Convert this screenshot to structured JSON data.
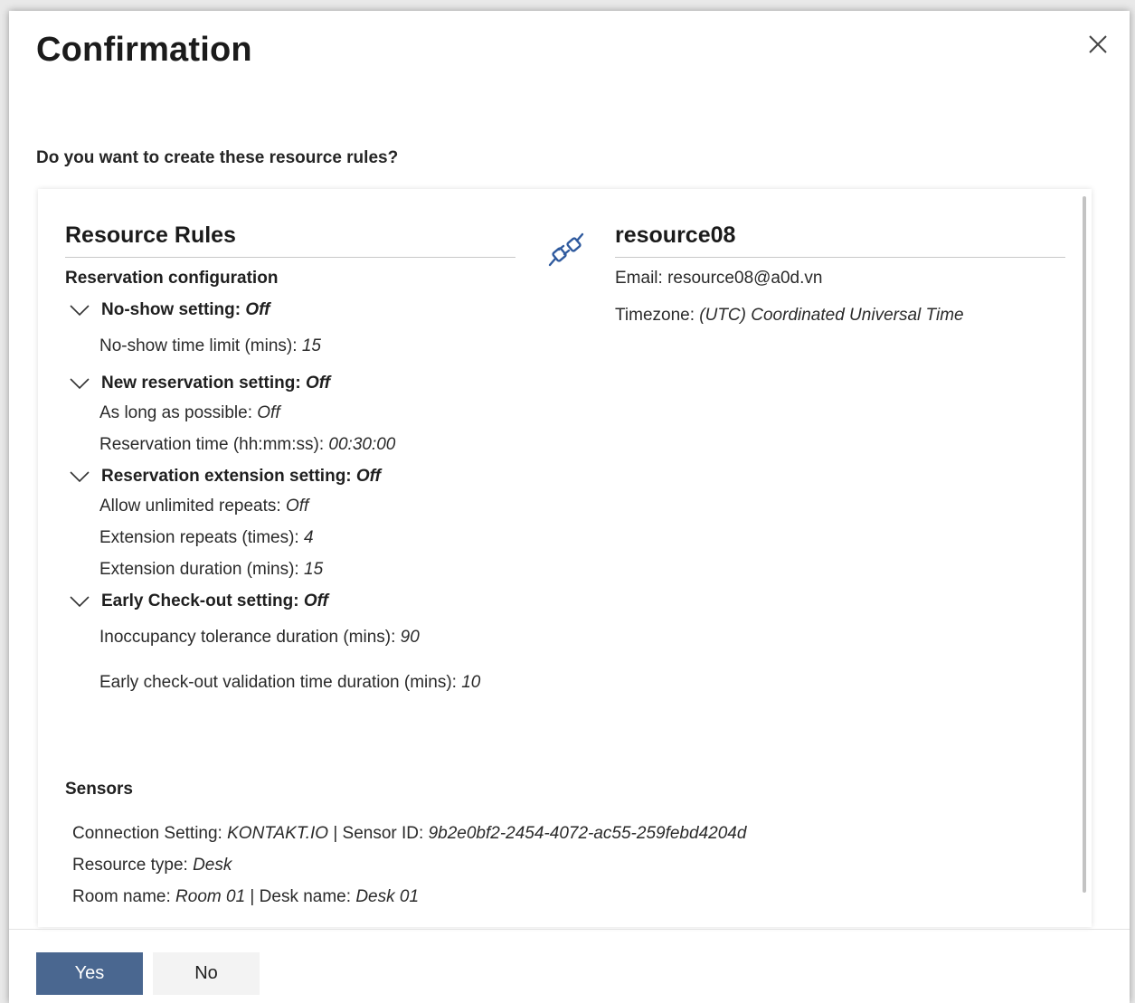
{
  "dialog": {
    "title": "Confirmation",
    "question": "Do you want to create these resource rules?",
    "close_icon": "close-icon"
  },
  "rules": {
    "title": "Resource Rules",
    "reservation_configuration": "Reservation configuration",
    "settings": [
      {
        "label": "No-show setting: ",
        "value": "Off",
        "details": [
          {
            "label": "No-show time limit (mins): ",
            "value": "15"
          }
        ]
      },
      {
        "label": "New reservation setting: ",
        "value": "Off",
        "details": [
          {
            "label": "As long as possible: ",
            "value": "Off"
          },
          {
            "label": "Reservation time (hh:mm:ss): ",
            "value": "00:30:00"
          }
        ]
      },
      {
        "label": "Reservation extension setting: ",
        "value": "Off",
        "details": [
          {
            "label": "Allow unlimited repeats: ",
            "value": "Off"
          },
          {
            "label": "Extension repeats (times): ",
            "value": "4"
          },
          {
            "label": "Extension duration (mins): ",
            "value": "15"
          }
        ]
      },
      {
        "label": "Early Check-out setting: ",
        "value": "Off",
        "details": [
          {
            "label": "Inoccupancy tolerance duration (mins): ",
            "value": "90"
          },
          {
            "label": "Early check-out validation time duration (mins): ",
            "value": "10"
          }
        ]
      }
    ]
  },
  "link_icon": "link-icon",
  "resource": {
    "name": "resource08",
    "email_label": "Email: ",
    "email": "resource08@a0d.vn",
    "timezone_label": "Timezone: ",
    "timezone": "(UTC) Coordinated Universal Time"
  },
  "sensors": {
    "title": "Sensors",
    "connection_label": "Connection Setting: ",
    "connection": "KONTAKT.IO",
    "separator": " | ",
    "sensor_id_label": "Sensor ID: ",
    "sensor_id": "9b2e0bf2-2454-4072-ac55-259febd4204d",
    "resource_type_label": "Resource type: ",
    "resource_type": "Desk",
    "room_label": "Room name: ",
    "room": "Room 01",
    "desk_label": "Desk name: ",
    "desk": "Desk 01"
  },
  "buttons": {
    "yes": "Yes",
    "no": "No"
  },
  "colors": {
    "primary": "#4a6790",
    "secondary": "#f3f3f3",
    "link_icon": "#2f5a9e"
  }
}
